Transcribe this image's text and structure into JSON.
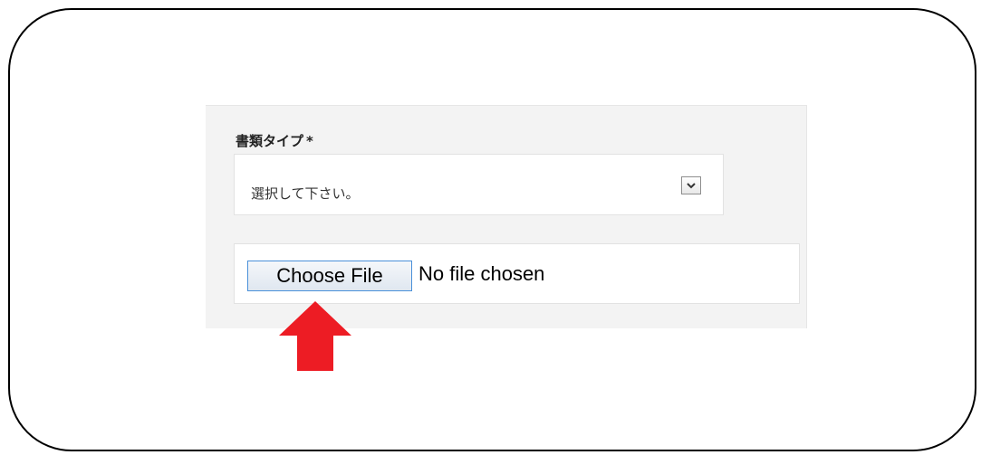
{
  "form": {
    "document_type_label": "書類タイプ",
    "required_mark": "*",
    "document_type_select": {
      "selected_text": "選択して下さい。",
      "arrow_icon": "chevron-down-icon"
    },
    "file_input": {
      "button_label": "Choose File",
      "status_text": "No file chosen"
    }
  },
  "annotation": {
    "arrow_icon": "arrow-up-icon",
    "arrow_color": "#ed1c24"
  },
  "colors": {
    "frame_border": "#000000",
    "panel_background": "#f3f3f3",
    "button_border": "#4a90d9"
  }
}
